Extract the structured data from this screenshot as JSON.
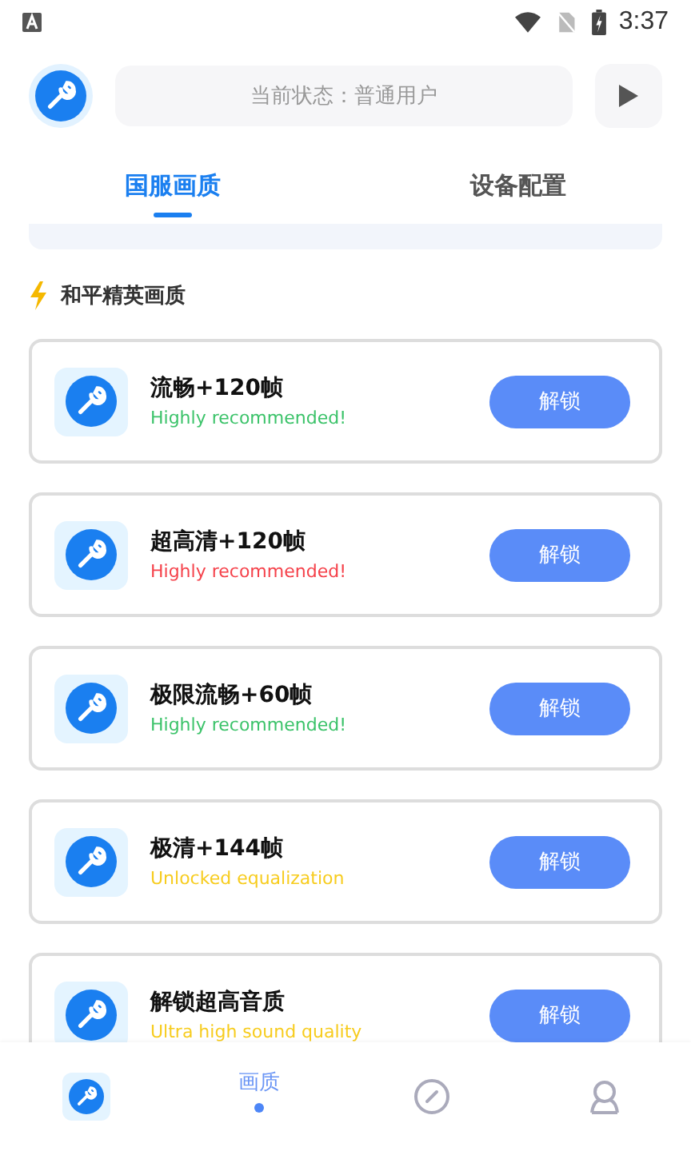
{
  "status_bar": {
    "time": "3:37"
  },
  "header": {
    "status_text": "当前状态：普通用户"
  },
  "tabs": [
    {
      "label": "国服画质",
      "selected": true
    },
    {
      "label": "设备配置",
      "selected": false
    }
  ],
  "section": {
    "title": "和平精英画质"
  },
  "items": [
    {
      "title": "流畅+120帧",
      "subtitle": "Highly recommended!",
      "color": "#3cc36a",
      "button": "解锁"
    },
    {
      "title": "超高清+120帧",
      "subtitle": "Highly recommended!",
      "color": "#f5424b",
      "button": "解锁"
    },
    {
      "title": "极限流畅+60帧",
      "subtitle": "Highly recommended!",
      "color": "#3cc36a",
      "button": "解锁"
    },
    {
      "title": "极清+144帧",
      "subtitle": "Unlocked equalization",
      "color": "#f7cc1e",
      "button": "解锁"
    },
    {
      "title": "解锁超高音质",
      "subtitle": "Ultra high sound quality",
      "color": "#f7cc1e",
      "button": "解锁"
    }
  ],
  "bottom_nav": [
    {
      "kind": "logo"
    },
    {
      "kind": "label",
      "label": "画质",
      "selected": true
    },
    {
      "kind": "compass"
    },
    {
      "kind": "person"
    }
  ]
}
